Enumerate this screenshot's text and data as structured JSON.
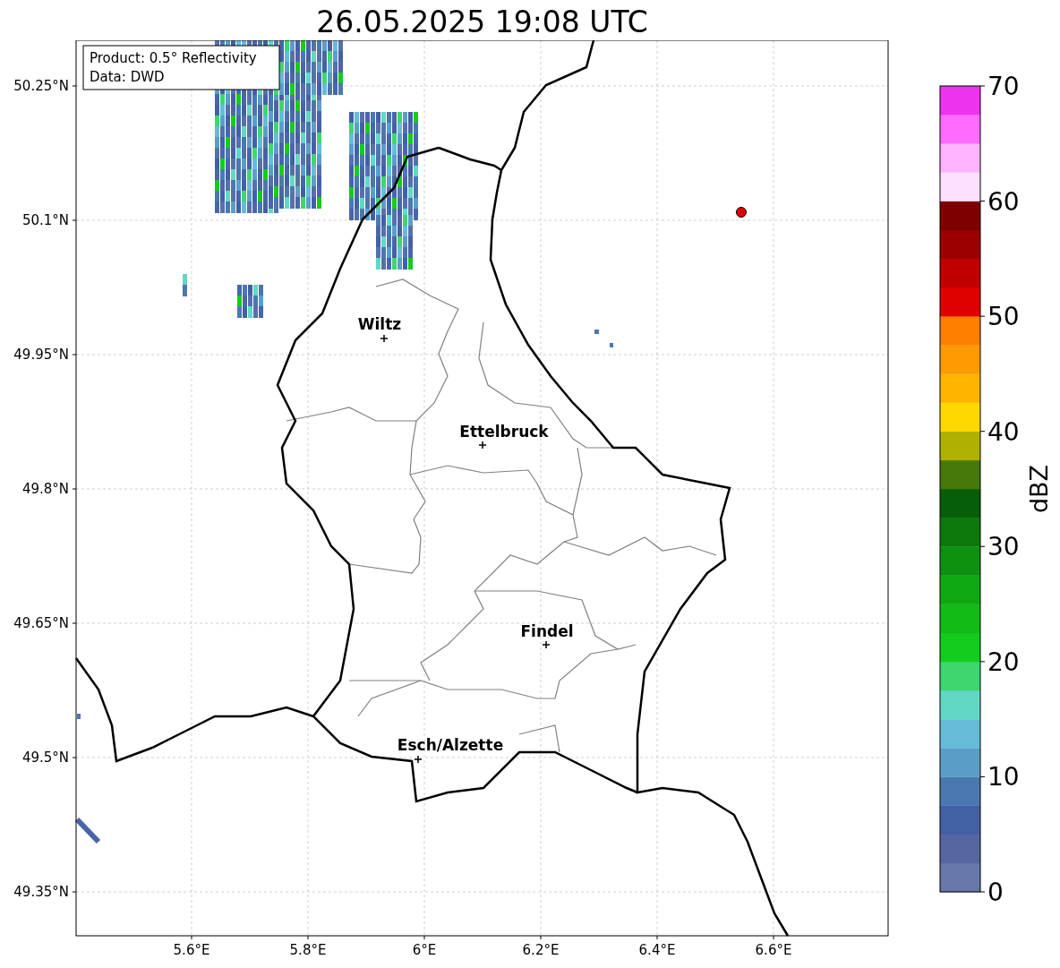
{
  "title": "26.05.2025 19:08 UTC",
  "info_box": [
    "Product: 0.5° Reflectivity",
    "Data: DWD"
  ],
  "y_ticks": [
    "50.25°N",
    "50.1°N",
    "49.95°N",
    "49.8°N",
    "49.65°N",
    "49.5°N",
    "49.35°N"
  ],
  "x_ticks": [
    "5.6°E",
    "5.8°E",
    "6°E",
    "6.2°E",
    "6.4°E",
    "6.6°E"
  ],
  "cities": [
    {
      "name": "Wiltz"
    },
    {
      "name": "Ettelbruck"
    },
    {
      "name": "Findel"
    },
    {
      "name": "Esch/Alzette"
    }
  ],
  "colorbar": {
    "label": "dBZ",
    "ticks": [
      "70",
      "60",
      "50",
      "40",
      "30",
      "20",
      "10",
      "0"
    ],
    "bins": [
      {
        "color": "#6677aa"
      },
      {
        "color": "#5566a0"
      },
      {
        "color": "#4460a5"
      },
      {
        "color": "#4a78b0"
      },
      {
        "color": "#5a9ec8"
      },
      {
        "color": "#64bcd9"
      },
      {
        "color": "#60d8c4"
      },
      {
        "color": "#3ed66e"
      },
      {
        "color": "#13cc1b"
      },
      {
        "color": "#12bb18"
      },
      {
        "color": "#10a812"
      },
      {
        "color": "#0e9010"
      },
      {
        "color": "#0b780c"
      },
      {
        "color": "#075e08"
      },
      {
        "color": "#46780a"
      },
      {
        "color": "#b0b000"
      },
      {
        "color": "#ffd800"
      },
      {
        "color": "#ffb400"
      },
      {
        "color": "#ff9a00"
      },
      {
        "color": "#ff7f00"
      },
      {
        "color": "#e00000"
      },
      {
        "color": "#c00000"
      },
      {
        "color": "#9c0000"
      },
      {
        "color": "#7e0000"
      },
      {
        "color": "#ffdfff"
      },
      {
        "color": "#ffb3ff"
      },
      {
        "color": "#ff6bff"
      },
      {
        "color": "#ee33ee"
      }
    ]
  }
}
